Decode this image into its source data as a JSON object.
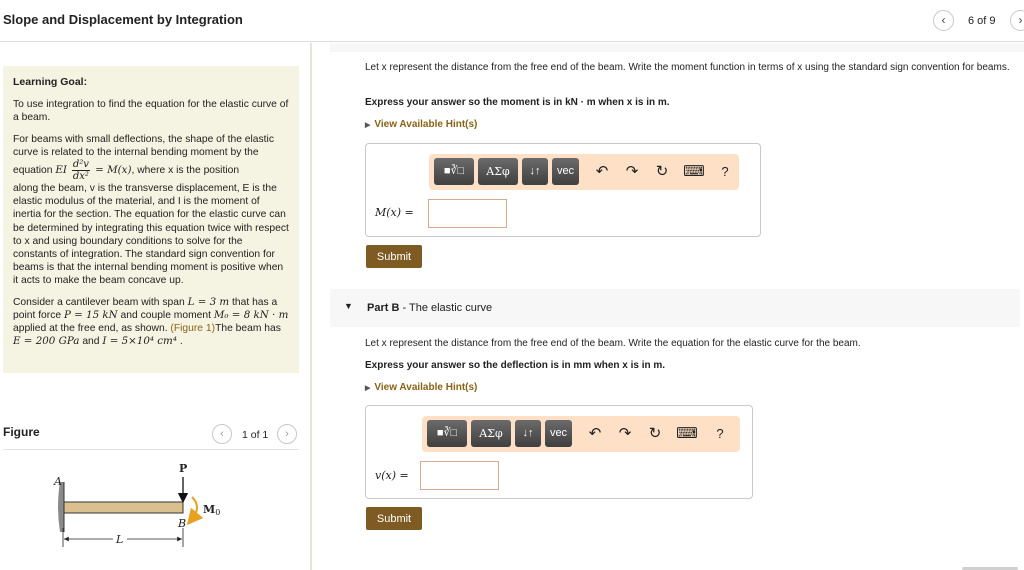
{
  "header": {
    "title": "Slope and Displacement by Integration",
    "page_counter": "6 of 9",
    "prev_icon": "‹",
    "next_icon": "›"
  },
  "learning_goal": {
    "heading": "Learning Goal:",
    "para1": "To use integration to find the equation for the elastic curve of a beam.",
    "para2_start": "For beams with small deflections, the shape of the elastic curve is related to the internal bending moment by the",
    "eq_prefix": "equation ",
    "eq_EI": "EI",
    "eq_num": "d²v",
    "eq_den": "dx²",
    "eq_rhs": " = M(x)",
    "eq_suffix": ", where x is the position",
    "para2_rest": "along the beam, v is the transverse displacement, E is the elastic modulus of the material, and I is the moment of inertia for the section. The equation for the elastic curve can be determined by integrating this equation twice with respect to x and using boundary conditions to solve for the constants of integration. The standard sign convention for beams is that the internal bending moment is positive when it acts to make the beam concave up.",
    "para3_a": "Consider a cantilever beam with span ",
    "L_val": "L = 3 m",
    "para3_b": " that has a point force ",
    "P_val": "P = 15 kN",
    "para3_c": " and couple moment ",
    "M0_val": "M₀ = 8 kN · m",
    "para3_d": " applied at the free end, as shown. ",
    "figure_link": "(Figure 1)",
    "para3_e": "The beam has ",
    "E_val": "E = 200 GPa",
    "para3_f": " and ",
    "I_val": "I = 5×10⁴ cm⁴",
    "para3_g": " ."
  },
  "figure": {
    "label": "Figure",
    "counter": "1 of 1",
    "prev_icon": "‹",
    "next_icon": "›",
    "labels": {
      "A": "A",
      "B": "B",
      "P": "P",
      "M0": "M",
      "M0_sub": "0",
      "L": "L"
    },
    "colors": {
      "beam": "#d9c08e",
      "moment_arrow": "#e8a020",
      "wall": "#888888"
    }
  },
  "part_a": {
    "prompt": "Let x represent the distance from the free end of the beam. Write the moment function in terms of x using the standard sign convention for beams.",
    "instruction": "Express your answer so the moment is in kN · m when x is in m.",
    "hint": "View Available Hint(s)",
    "answer_label": "M(x) =",
    "answer_value": "",
    "submit": "Submit"
  },
  "part_b": {
    "header_bold": "Part B",
    "header_rest": " - The elastic curve",
    "prompt": "Let x represent the distance from the free end of the beam. Write the equation for the elastic curve for the beam.",
    "instruction": "Express your answer so the deflection is in mm when x is in m.",
    "hint": "View Available Hint(s)",
    "answer_label": "v(x) =",
    "answer_value": "",
    "submit": "Submit"
  },
  "toolbar": {
    "templates": "■∛□",
    "greek": "ΑΣφ",
    "arrows": "↓↑",
    "vec": "vec",
    "undo": "↶",
    "redo": "↷",
    "reset": "↻",
    "keyboard": "⌨",
    "help": "?"
  },
  "colors": {
    "accent": "#7e5b22",
    "hint_link": "#8a6317",
    "goal_bg": "#f5f3e1",
    "toolbar_bg": "#fde0c6"
  }
}
